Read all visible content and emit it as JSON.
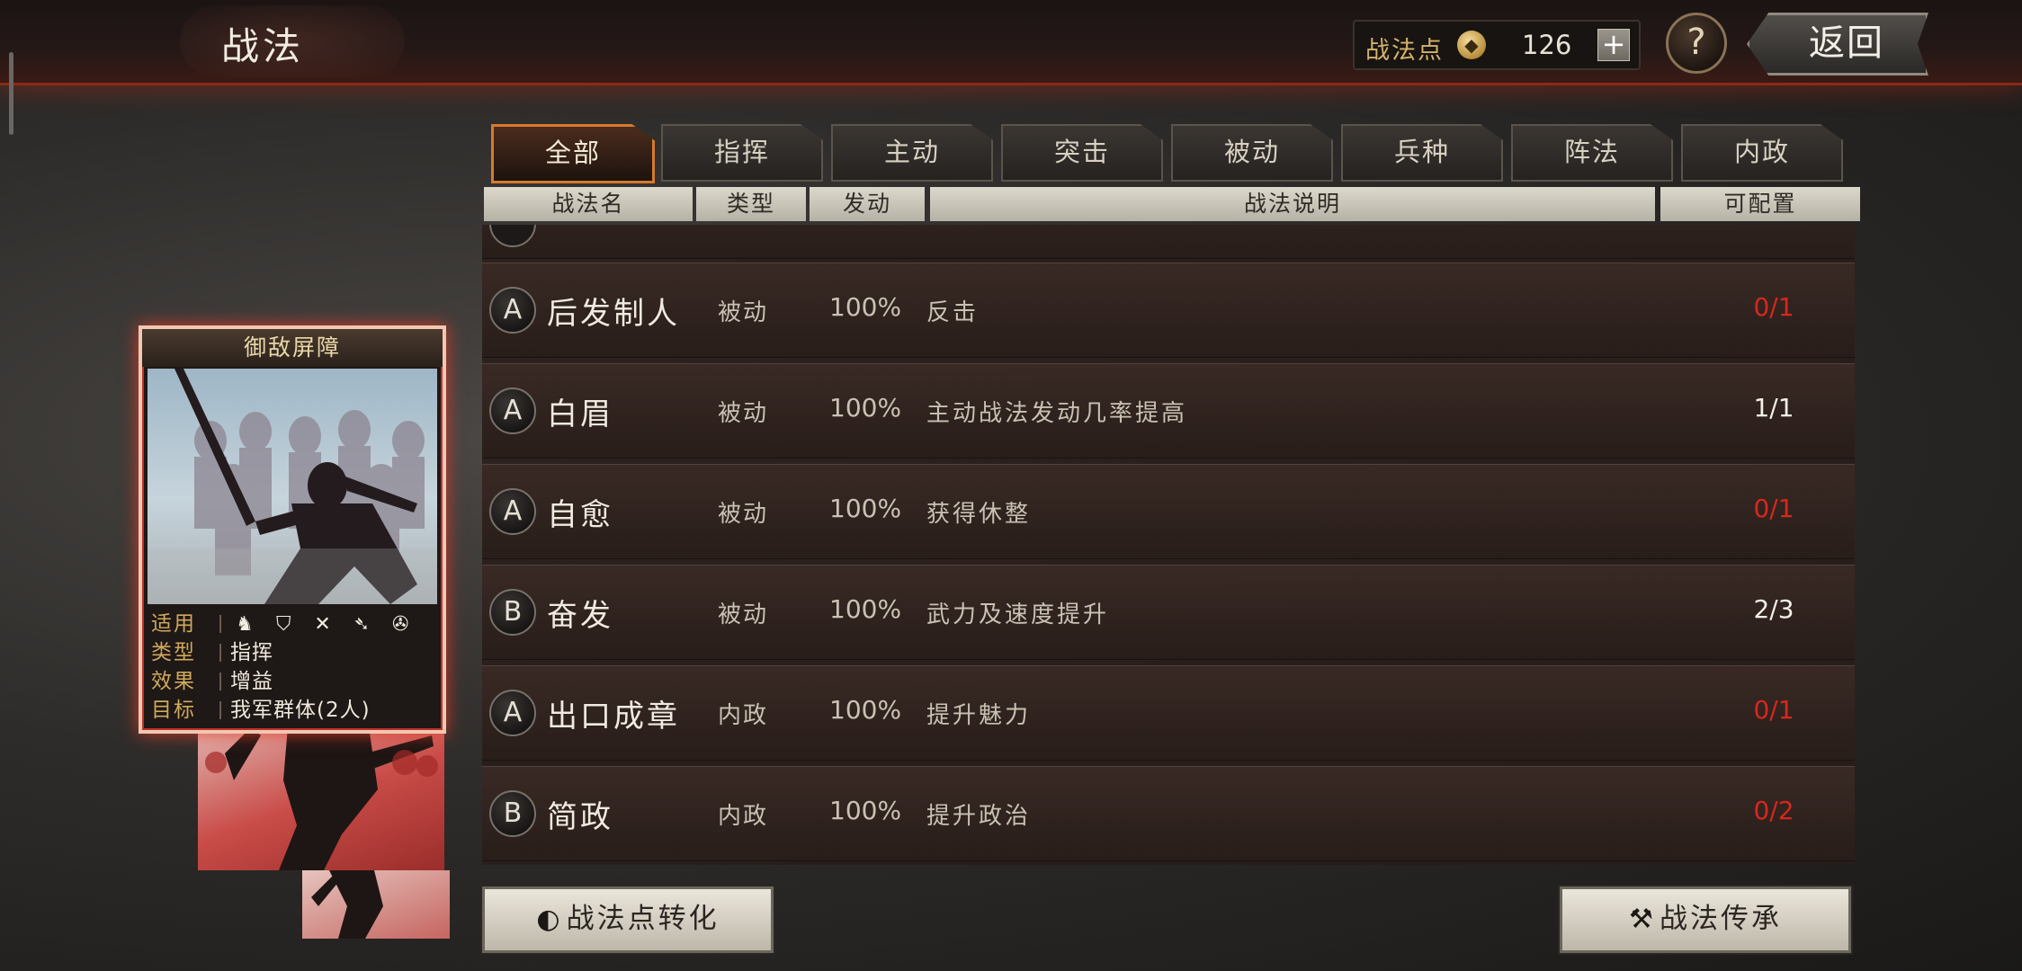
{
  "header": {
    "title": "战法",
    "points_label": "战法点",
    "points_value": "126",
    "plus_label": "+",
    "help_label": "?",
    "back_label": "返回"
  },
  "tabs": [
    "全部",
    "指挥",
    "主动",
    "突击",
    "被动",
    "兵种",
    "阵法",
    "内政"
  ],
  "active_tab": "全部",
  "columns": {
    "name": "战法名",
    "type": "类型",
    "rate": "发动",
    "desc": "战法说明",
    "config": "可配置"
  },
  "rows": [
    {
      "grade": "A",
      "name": "后发制人",
      "type": "被动",
      "rate": "100%",
      "desc": "反击",
      "config": "0/1",
      "config_color": "#d6281d"
    },
    {
      "grade": "A",
      "name": "白眉",
      "type": "被动",
      "rate": "100%",
      "desc": "主动战法发动几率提高",
      "config": "1/1",
      "config_color": "#f3f0e8"
    },
    {
      "grade": "A",
      "name": "自愈",
      "type": "被动",
      "rate": "100%",
      "desc": "获得休整",
      "config": "0/1",
      "config_color": "#d6281d"
    },
    {
      "grade": "B",
      "name": "奋发",
      "type": "被动",
      "rate": "100%",
      "desc": "武力及速度提升",
      "config": "2/3",
      "config_color": "#f3f0e8"
    },
    {
      "grade": "A",
      "name": "出口成章",
      "type": "内政",
      "rate": "100%",
      "desc": "提升魅力",
      "config": "0/1",
      "config_color": "#d6281d"
    },
    {
      "grade": "B",
      "name": "简政",
      "type": "内政",
      "rate": "100%",
      "desc": "提升政治",
      "config": "0/2",
      "config_color": "#d6281d"
    }
  ],
  "card": {
    "title": "御敌屏障",
    "applies_label": "适用",
    "type_label": "类型",
    "type_value": "指挥",
    "effect_label": "效果",
    "effect_value": "增益",
    "target_label": "目标",
    "target_value": "我军群体(2人)",
    "troop_icons": [
      "cavalry-icon",
      "shield-icon",
      "bow-icon",
      "spear-icon",
      "wheel-icon"
    ]
  },
  "buttons": {
    "convert_label": "战法点转化",
    "inherit_label": "战法传承"
  },
  "colors": {
    "accent_orange": "#d57a2c",
    "config_full": "#d6281d",
    "card_label": "#d1a95c"
  }
}
